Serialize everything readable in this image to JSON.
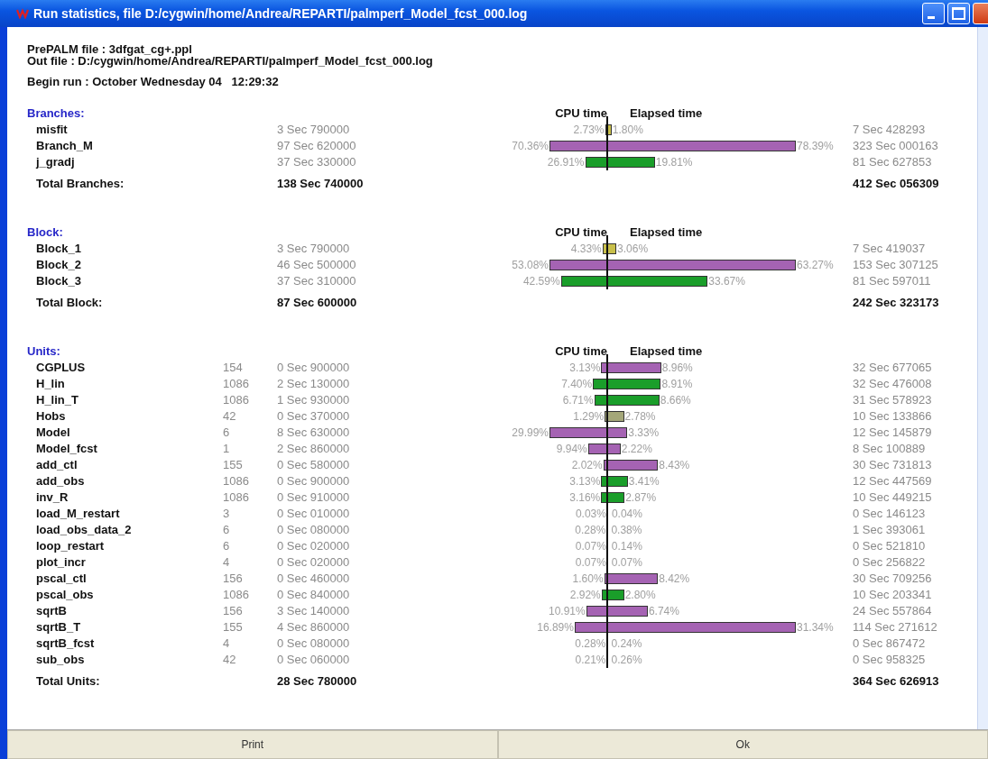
{
  "window": {
    "title": "Run statistics, file D:/cygwin/home/Andrea/REPARTI/palmperf_Model_fcst_000.log"
  },
  "header": {
    "prepalm_file": "PrePALM file : 3dfgat_cg+.ppl",
    "out_file": "Out file : D:/cygwin/home/Andrea/REPARTI/palmperf_Model_fcst_000.log",
    "begin_run": "Begin run : October Wednesday 04   12:29:32"
  },
  "sections": [
    {
      "heading": "Branches:",
      "cpu_label": "CPU time",
      "elapsed_label": "Elapsed time",
      "rows": [
        {
          "name": "misfit",
          "cpu_time": "3 Sec 790000",
          "cpu_pct": "2.73%",
          "elapsed_pct": "1.80%",
          "elapsed_time": "7 Sec 428293",
          "color": "#c8bf4a"
        },
        {
          "name": "Branch_M",
          "cpu_time": "97 Sec 620000",
          "cpu_pct": "70.36%",
          "elapsed_pct": "78.39%",
          "elapsed_time": "323 Sec 000163",
          "color": "#a563b3"
        },
        {
          "name": "j_gradj",
          "cpu_time": "37 Sec 330000",
          "cpu_pct": "26.91%",
          "elapsed_pct": "19.81%",
          "elapsed_time": "81 Sec 627853",
          "color": "#1a9e2a"
        }
      ],
      "total": {
        "label": "Total Branches:",
        "cpu_time": "138 Sec 740000",
        "elapsed_time": "412 Sec 056309"
      }
    },
    {
      "heading": "Block:",
      "cpu_label": "CPU time",
      "elapsed_label": "Elapsed time",
      "rows": [
        {
          "name": "Block_1",
          "cpu_time": "3 Sec 790000",
          "cpu_pct": "4.33%",
          "elapsed_pct": "3.06%",
          "elapsed_time": "7 Sec 419037",
          "color": "#c8bf4a"
        },
        {
          "name": "Block_2",
          "cpu_time": "46 Sec 500000",
          "cpu_pct": "53.08%",
          "elapsed_pct": "63.27%",
          "elapsed_time": "153 Sec 307125",
          "color": "#a563b3"
        },
        {
          "name": "Block_3",
          "cpu_time": "37 Sec 310000",
          "cpu_pct": "42.59%",
          "elapsed_pct": "33.67%",
          "elapsed_time": "81 Sec 597011",
          "color": "#1a9e2a"
        }
      ],
      "total": {
        "label": "Total Block:",
        "cpu_time": "87 Sec 600000",
        "elapsed_time": "242 Sec 323173"
      }
    },
    {
      "heading": "Units:",
      "cpu_label": "CPU time",
      "elapsed_label": "Elapsed time",
      "rows": [
        {
          "name": "CGPLUS",
          "count": "154",
          "cpu_time": "0 Sec 900000",
          "cpu_pct": "3.13%",
          "elapsed_pct": "8.96%",
          "elapsed_time": "32 Sec 677065",
          "color": "#a563b3"
        },
        {
          "name": "H_lin",
          "count": "1086",
          "cpu_time": "2 Sec 130000",
          "cpu_pct": "7.40%",
          "elapsed_pct": "8.91%",
          "elapsed_time": "32 Sec 476008",
          "color": "#1a9e2a"
        },
        {
          "name": "H_lin_T",
          "count": "1086",
          "cpu_time": "1 Sec 930000",
          "cpu_pct": "6.71%",
          "elapsed_pct": "8.66%",
          "elapsed_time": "31 Sec 578923",
          "color": "#1a9e2a"
        },
        {
          "name": "Hobs",
          "count": "42",
          "cpu_time": "0 Sec 370000",
          "cpu_pct": "1.29%",
          "elapsed_pct": "2.78%",
          "elapsed_time": "10 Sec 133866",
          "color": "#a4a779"
        },
        {
          "name": "Model",
          "count": "6",
          "cpu_time": "8 Sec 630000",
          "cpu_pct": "29.99%",
          "elapsed_pct": "3.33%",
          "elapsed_time": "12 Sec 145879",
          "color": "#a563b3"
        },
        {
          "name": "Model_fcst",
          "count": "1",
          "cpu_time": "2 Sec 860000",
          "cpu_pct": "9.94%",
          "elapsed_pct": "2.22%",
          "elapsed_time": "8 Sec 100889",
          "color": "#a563b3"
        },
        {
          "name": "add_ctl",
          "count": "155",
          "cpu_time": "0 Sec 580000",
          "cpu_pct": "2.02%",
          "elapsed_pct": "8.43%",
          "elapsed_time": "30 Sec 731813",
          "color": "#a563b3"
        },
        {
          "name": "add_obs",
          "count": "1086",
          "cpu_time": "0 Sec 900000",
          "cpu_pct": "3.13%",
          "elapsed_pct": "3.41%",
          "elapsed_time": "12 Sec 447569",
          "color": "#1a9e2a"
        },
        {
          "name": "inv_R",
          "count": "1086",
          "cpu_time": "0 Sec 910000",
          "cpu_pct": "3.16%",
          "elapsed_pct": "2.87%",
          "elapsed_time": "10 Sec 449215",
          "color": "#1a9e2a"
        },
        {
          "name": "load_M_restart",
          "count": "3",
          "cpu_time": "0 Sec 010000",
          "cpu_pct": "0.03%",
          "elapsed_pct": "0.04%",
          "elapsed_time": "0 Sec 146123"
        },
        {
          "name": "load_obs_data_2",
          "count": "6",
          "cpu_time": "0 Sec 080000",
          "cpu_pct": "0.28%",
          "elapsed_pct": "0.38%",
          "elapsed_time": "1 Sec 393061"
        },
        {
          "name": "loop_restart",
          "count": "6",
          "cpu_time": "0 Sec 020000",
          "cpu_pct": "0.07%",
          "elapsed_pct": "0.14%",
          "elapsed_time": "0 Sec 521810"
        },
        {
          "name": "plot_incr",
          "count": "4",
          "cpu_time": "0 Sec 020000",
          "cpu_pct": "0.07%",
          "elapsed_pct": "0.07%",
          "elapsed_time": "0 Sec 256822"
        },
        {
          "name": "pscal_ctl",
          "count": "156",
          "cpu_time": "0 Sec 460000",
          "cpu_pct": "1.60%",
          "elapsed_pct": "8.42%",
          "elapsed_time": "30 Sec 709256",
          "color": "#a563b3"
        },
        {
          "name": "pscal_obs",
          "count": "1086",
          "cpu_time": "0 Sec 840000",
          "cpu_pct": "2.92%",
          "elapsed_pct": "2.80%",
          "elapsed_time": "10 Sec 203341",
          "color": "#1a9e2a"
        },
        {
          "name": "sqrtB",
          "count": "156",
          "cpu_time": "3 Sec 140000",
          "cpu_pct": "10.91%",
          "elapsed_pct": "6.74%",
          "elapsed_time": "24 Sec 557864",
          "color": "#a563b3"
        },
        {
          "name": "sqrtB_T",
          "count": "155",
          "cpu_time": "4 Sec 860000",
          "cpu_pct": "16.89%",
          "elapsed_pct": "31.34%",
          "elapsed_time": "114 Sec 271612",
          "color": "#a563b3"
        },
        {
          "name": "sqrtB_fcst",
          "count": "4",
          "cpu_time": "0 Sec 080000",
          "cpu_pct": "0.28%",
          "elapsed_pct": "0.24%",
          "elapsed_time": "0 Sec 867472"
        },
        {
          "name": "sub_obs",
          "count": "42",
          "cpu_time": "0 Sec 060000",
          "cpu_pct": "0.21%",
          "elapsed_pct": "0.26%",
          "elapsed_time": "0 Sec 958325"
        }
      ],
      "total": {
        "label": "Total Units:",
        "cpu_time": "28 Sec 780000",
        "elapsed_time": "364 Sec 626913"
      }
    }
  ],
  "buttons": [
    {
      "label": "Print"
    },
    {
      "label": "Ok"
    }
  ]
}
